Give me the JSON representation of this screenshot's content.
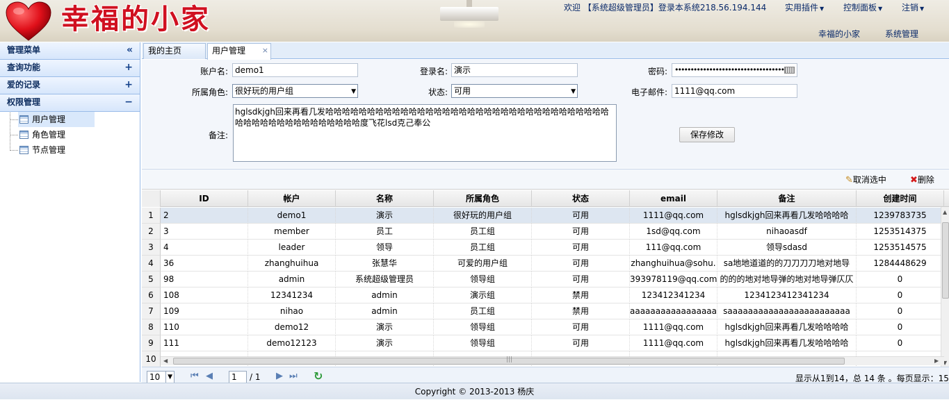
{
  "header": {
    "logo_text": "幸福的小家",
    "welcome_text": "欢迎 【系统超级管理员】登录本系统218.56.194.144",
    "menus": [
      "实用插件",
      "控制面板",
      "注销"
    ],
    "subnav": [
      "幸福的小家",
      "系统管理"
    ]
  },
  "sidebar": {
    "title": "管理菜单",
    "collapse_symbol": "«",
    "sections": [
      {
        "label": "查询功能",
        "toggle": "+"
      },
      {
        "label": "爱的记录",
        "toggle": "+"
      },
      {
        "label": "权限管理",
        "toggle": "−"
      }
    ],
    "tree_items": [
      "用户管理",
      "角色管理",
      "节点管理"
    ]
  },
  "tabs": [
    {
      "label": "我的主页"
    },
    {
      "label": "用户管理",
      "close": "×"
    }
  ],
  "form": {
    "account_label": "账户名:",
    "account_value": "demo1",
    "login_label": "登录名:",
    "login_value": "演示",
    "password_label": "密码:",
    "password_value": "•••••••••••••••••••••••••••••••••••",
    "role_label": "所属角色:",
    "role_value": "很好玩的用户组",
    "status_label": "状态:",
    "status_value": "可用",
    "email_label": "电子邮件:",
    "email_value": "1111@qq.com",
    "remark_label": "备注:",
    "remark_value": "hglsdkjgh回来再看几发哈哈哈哈哈哈哈哈哈哈哈哈哈哈哈哈哈哈哈哈哈哈哈哈哈哈哈哈哈哈哈哈哈哈哈哈哈哈哈哈哈哈哈哈哈哈哈哈哈度飞花lsd克己奉公",
    "save_label": "保存修改"
  },
  "toolbar": {
    "deselect_label": "取消选中",
    "delete_label": "删除"
  },
  "grid": {
    "columns": [
      "ID",
      "帐户",
      "名称",
      "所属角色",
      "状态",
      "email",
      "备注",
      "创建时间"
    ],
    "rows": [
      {
        "num": "1",
        "cells": [
          "2",
          "demo1",
          "演示",
          "很好玩的用户组",
          "可用",
          "1111@qq.com",
          "hglsdkjgh回来再看几发哈哈哈哈",
          "1239783735"
        ]
      },
      {
        "num": "2",
        "cells": [
          "3",
          "member",
          "员工",
          "员工组",
          "可用",
          "1sd@qq.com",
          "nihaoasdf",
          "1253514375"
        ]
      },
      {
        "num": "3",
        "cells": [
          "4",
          "leader",
          "领导",
          "员工组",
          "可用",
          "111@qq.com",
          "领导sdasd",
          "1253514575"
        ]
      },
      {
        "num": "4",
        "cells": [
          "36",
          "zhanghuihua",
          "张慧华",
          "可爱的用户组",
          "可用",
          "zhanghuihua@sohu.",
          "sa地地道道的的刀刀刀刀地对地导",
          "1284448629"
        ]
      },
      {
        "num": "5",
        "cells": [
          "98",
          "admin",
          "系统超级管理员",
          "领导组",
          "可用",
          "393978119@qq.com",
          "的的的地对地导弹的地对地导弹仄仄",
          "0"
        ]
      },
      {
        "num": "6",
        "cells": [
          "108",
          "12341234",
          "admin",
          "演示组",
          "禁用",
          "123412341234",
          "1234123412341234",
          "0"
        ]
      },
      {
        "num": "7",
        "cells": [
          "109",
          "nihao",
          "admin",
          "员工组",
          "禁用",
          "aaaaaaaaaaaaaaaaa",
          "saaaaaaaaaaaaaaaaaaaaaaaa",
          "0"
        ]
      },
      {
        "num": "8",
        "cells": [
          "110",
          "demo12",
          "演示",
          "领导组",
          "可用",
          "1111@qq.com",
          "hglsdkjgh回来再看几发哈哈哈哈",
          "0"
        ]
      },
      {
        "num": "9",
        "cells": [
          "111",
          "demo12123",
          "演示",
          "领导组",
          "可用",
          "1111@qq.com",
          "hglsdkjgh回来再看几发哈哈哈哈",
          "0"
        ]
      },
      {
        "num": "10",
        "cells": [
          "",
          "",
          "",
          "",
          "",
          "",
          "",
          ""
        ]
      }
    ]
  },
  "pager": {
    "page_size": "10",
    "current_page": "1",
    "total_pages": "/ 1",
    "info": "显示从1到14，总 14 条 。每页显示：15"
  },
  "footer": {
    "copyright": "Copyright © 2013-2013 杨庆"
  },
  "colors": {
    "logo_red": "#d01020",
    "heart_red": "#e0101a",
    "accent_blue": "#99bbe8"
  }
}
